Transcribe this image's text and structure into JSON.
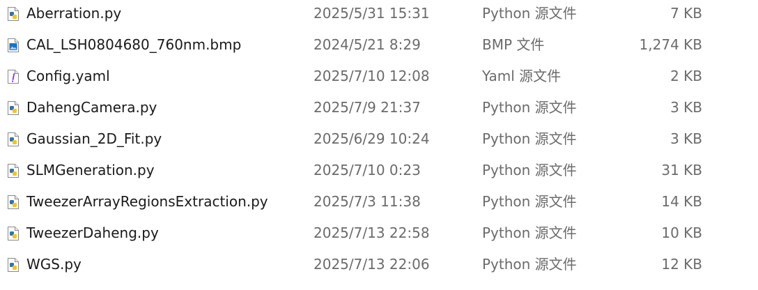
{
  "files": [
    {
      "name": "Aberration.py",
      "date": "2025/5/31 15:31",
      "type": "Python 源文件",
      "size": "7 KB",
      "icon": "python-file-icon"
    },
    {
      "name": "CAL_LSH0804680_760nm.bmp",
      "date": "2024/5/21 8:29",
      "type": "BMP 文件",
      "size": "1,274 KB",
      "icon": "image-file-icon"
    },
    {
      "name": "Config.yaml",
      "date": "2025/7/10 12:08",
      "type": "Yaml 源文件",
      "size": "2 KB",
      "icon": "yaml-file-icon"
    },
    {
      "name": "DahengCamera.py",
      "date": "2025/7/9 21:37",
      "type": "Python 源文件",
      "size": "3 KB",
      "icon": "python-file-icon"
    },
    {
      "name": "Gaussian_2D_Fit.py",
      "date": "2025/6/29 10:24",
      "type": "Python 源文件",
      "size": "3 KB",
      "icon": "python-file-icon"
    },
    {
      "name": "SLMGeneration.py",
      "date": "2025/7/10 0:23",
      "type": "Python 源文件",
      "size": "31 KB",
      "icon": "python-file-icon"
    },
    {
      "name": "TweezerArrayRegionsExtraction.py",
      "date": "2025/7/3 11:38",
      "type": "Python 源文件",
      "size": "14 KB",
      "icon": "python-file-icon"
    },
    {
      "name": "TweezerDaheng.py",
      "date": "2025/7/13 22:58",
      "type": "Python 源文件",
      "size": "10 KB",
      "icon": "python-file-icon"
    },
    {
      "name": "WGS.py",
      "date": "2025/7/13 22:06",
      "type": "Python 源文件",
      "size": "12 KB",
      "icon": "python-file-icon"
    }
  ],
  "colors": {
    "name_text": "#1a1a1a",
    "meta_text": "#6b6b6b",
    "python_blue": "#3572a5",
    "python_yellow": "#f2c230",
    "image_blue": "#1e6fc2",
    "yaml_purple": "#8a2be2"
  }
}
